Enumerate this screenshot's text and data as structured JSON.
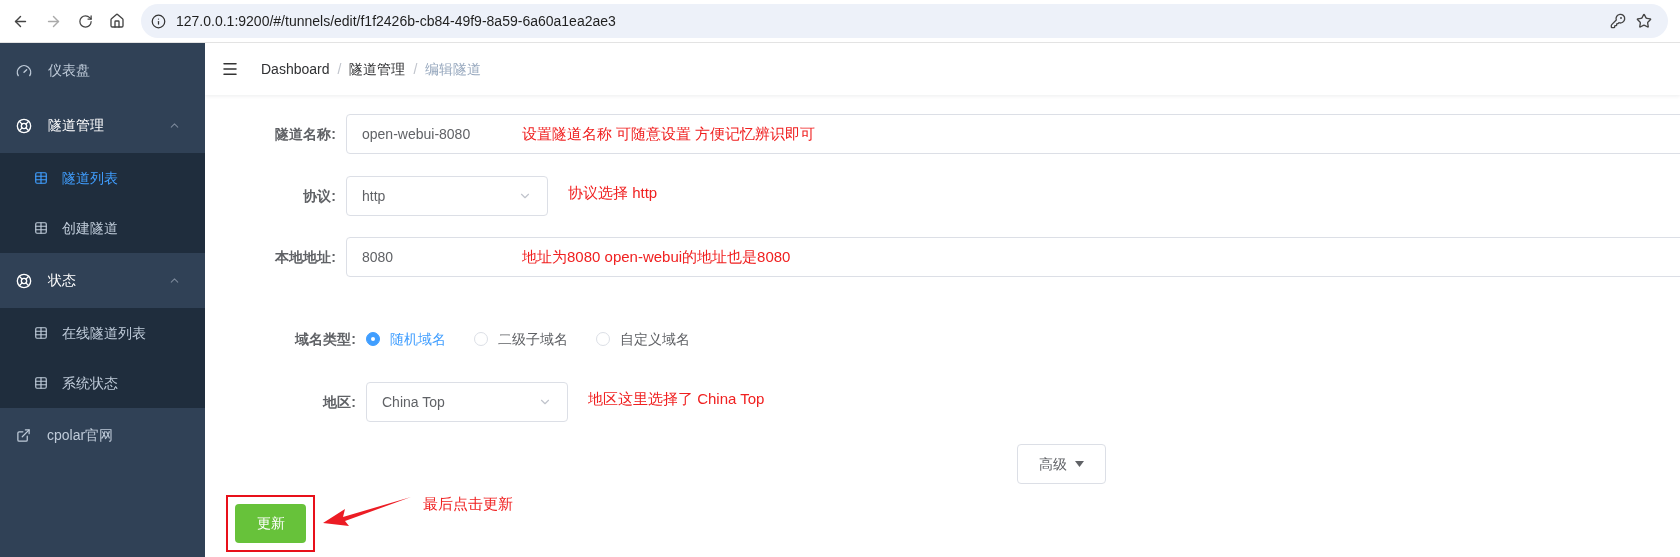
{
  "browser": {
    "url": "127.0.0.1:9200/#/tunnels/edit/f1f2426b-cb84-49f9-8a59-6a60a1ea2ae3"
  },
  "sidebar": {
    "items": [
      {
        "kind": "dashboard",
        "label": "仪表盘"
      },
      {
        "kind": "group",
        "label": "隧道管理",
        "expanded": true,
        "children": [
          {
            "label": "隧道列表",
            "selected": true
          },
          {
            "label": "创建隧道",
            "selected": false
          }
        ]
      },
      {
        "kind": "group",
        "label": "状态",
        "expanded": true,
        "children": [
          {
            "label": "在线隧道列表",
            "selected": false
          },
          {
            "label": "系统状态",
            "selected": false
          }
        ]
      },
      {
        "kind": "external",
        "label": "cpolar官网"
      }
    ]
  },
  "breadcrumb": {
    "separators": [
      "/",
      "/"
    ],
    "items": [
      "Dashboard",
      "隧道管理",
      "编辑隧道"
    ]
  },
  "form": {
    "fields": [
      {
        "kind": "text",
        "label": "隧道名称:",
        "value": "open-webui-8080",
        "note": "设置隧道名称  可随意设置 方便记忆辨识即可"
      },
      {
        "kind": "select",
        "label": "协议:",
        "value": "http",
        "note": "协议选择 http"
      },
      {
        "kind": "text",
        "label": "本地地址:",
        "value": "8080",
        "note": "地址为8080   open-webui的地址也是8080"
      },
      {
        "kind": "radio",
        "label": "域名类型:",
        "options": [
          {
            "label": "随机域名",
            "selected": true
          },
          {
            "label": "二级子域名",
            "selected": false
          },
          {
            "label": "自定义域名",
            "selected": false
          }
        ]
      },
      {
        "kind": "select",
        "label": "地区:",
        "value": "China Top",
        "note": "地区这里选择了 China Top"
      }
    ],
    "advanced_button": "高级",
    "submit_button": "更新",
    "submit_note": "最后点击更新"
  }
}
